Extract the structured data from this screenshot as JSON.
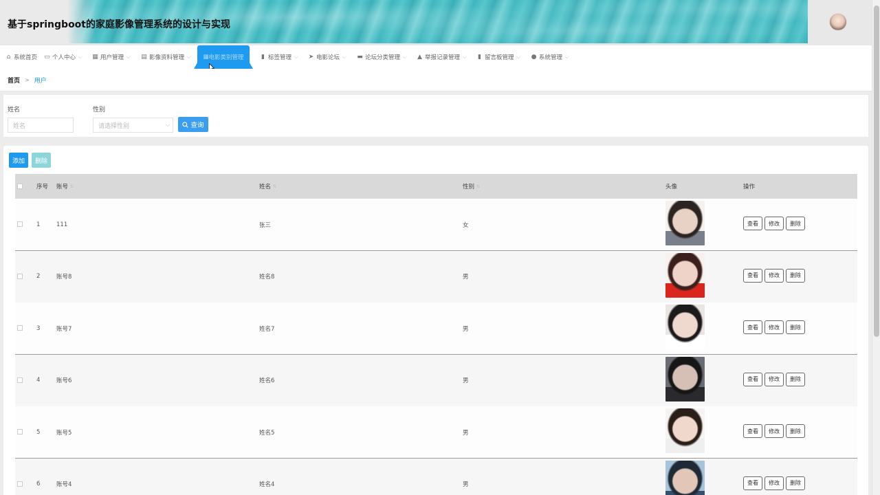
{
  "header": {
    "title": "基于springboot的家庭影像管理系统的设计与实现"
  },
  "nav": {
    "items": [
      {
        "label": "系统首页",
        "icon": "home-icon"
      },
      {
        "label": "个人中心",
        "icon": "id-card-icon"
      },
      {
        "label": "用户管理",
        "icon": "grid-icon"
      },
      {
        "label": "影像资料管理",
        "icon": "message-icon"
      },
      {
        "label": "电影类别管理",
        "icon": "grid-icon",
        "active": true
      },
      {
        "label": "标签管理",
        "icon": "document-icon"
      },
      {
        "label": "电影论坛",
        "icon": "send-icon"
      },
      {
        "label": "论坛分类管理",
        "icon": "ticket-icon"
      },
      {
        "label": "举报记录管理",
        "icon": "thumb-icon"
      },
      {
        "label": "留言板管理",
        "icon": "clipboard-icon"
      },
      {
        "label": "系统管理",
        "icon": "user-icon"
      }
    ],
    "active_color": "#1e9bf0"
  },
  "breadcrumb": {
    "home": "首页",
    "separator": ">",
    "current": "用户"
  },
  "search": {
    "name_label": "姓名",
    "name_placeholder": "姓名",
    "gender_label": "性别",
    "gender_placeholder": "请选择性别",
    "query_button": "查询"
  },
  "actions": {
    "add": "添加",
    "delete": "删除"
  },
  "table": {
    "headers": {
      "index": "序号",
      "account": "账号",
      "name": "姓名",
      "gender": "性别",
      "avatar": "头像",
      "ops": "操作"
    },
    "op_labels": {
      "view": "查看",
      "edit": "修改",
      "delete": "删除"
    },
    "rows": [
      {
        "index": "1",
        "account": "111",
        "name": "张三",
        "gender": "女"
      },
      {
        "index": "2",
        "account": "账号8",
        "name": "姓名8",
        "gender": "男"
      },
      {
        "index": "3",
        "account": "账号7",
        "name": "姓名7",
        "gender": "男"
      },
      {
        "index": "4",
        "account": "账号6",
        "name": "姓名6",
        "gender": "男"
      },
      {
        "index": "5",
        "account": "账号5",
        "name": "姓名5",
        "gender": "男"
      },
      {
        "index": "6",
        "account": "账号4",
        "name": "姓名4",
        "gender": "男"
      }
    ]
  }
}
